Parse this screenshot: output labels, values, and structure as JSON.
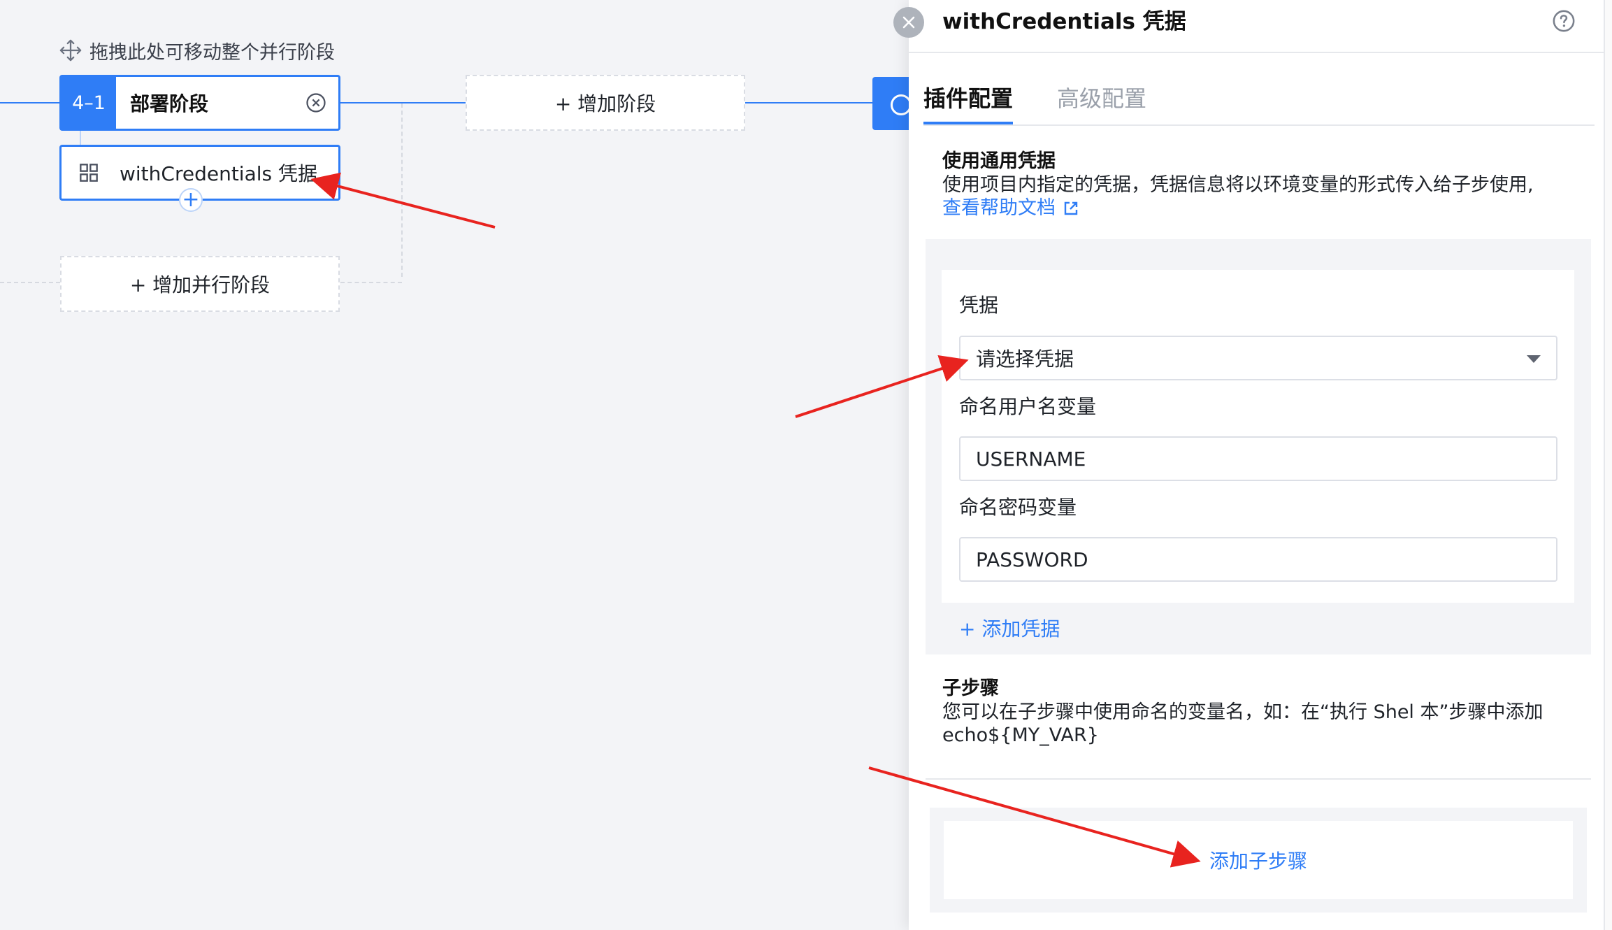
{
  "canvas": {
    "drag_hint": "拖拽此处可移动整个并行阶段",
    "stage": {
      "number": "4–1",
      "name": "部署阶段"
    },
    "step": {
      "label": "withCredentials 凭据",
      "add_symbol": "+"
    },
    "add_stage": "+ 增加阶段",
    "add_parallel_stage": "+ 增加并行阶段"
  },
  "panel": {
    "title": "withCredentials 凭据",
    "tabs": [
      {
        "label": "插件配置",
        "active": true
      },
      {
        "label": "高级配置",
        "active": false
      }
    ],
    "credentials_section": {
      "title": "使用通用凭据",
      "description": "使用项目内指定的凭据，凭据信息将以环境变量的形式传入给子步使用,",
      "help_link": "查看帮助文档"
    },
    "form": {
      "credential_label": "凭据",
      "credential_placeholder": "请选择凭据",
      "username_var_label": "命名用户名变量",
      "username_var_value": "USERNAME",
      "password_var_label": "命名密码变量",
      "password_var_value": "PASSWORD",
      "add_credential": "+ 添加凭据"
    },
    "substeps_section": {
      "title": "子步骤",
      "description_line1": "您可以在子步骤中使用命名的变量名，如：在“执行 Shel 本”步骤中添加",
      "description_line2": "echo${MY_VAR}",
      "add_substep": "添加子步骤"
    }
  },
  "colors": {
    "accent": "#2f7df6",
    "annotation_arrow": "#e8231f",
    "canvas_bg": "#f3f4f7"
  },
  "icons": [
    "move-icon",
    "close-circle-icon",
    "grid-icon",
    "close-icon",
    "help-icon",
    "external-link-icon",
    "dropdown-caret-icon"
  ]
}
